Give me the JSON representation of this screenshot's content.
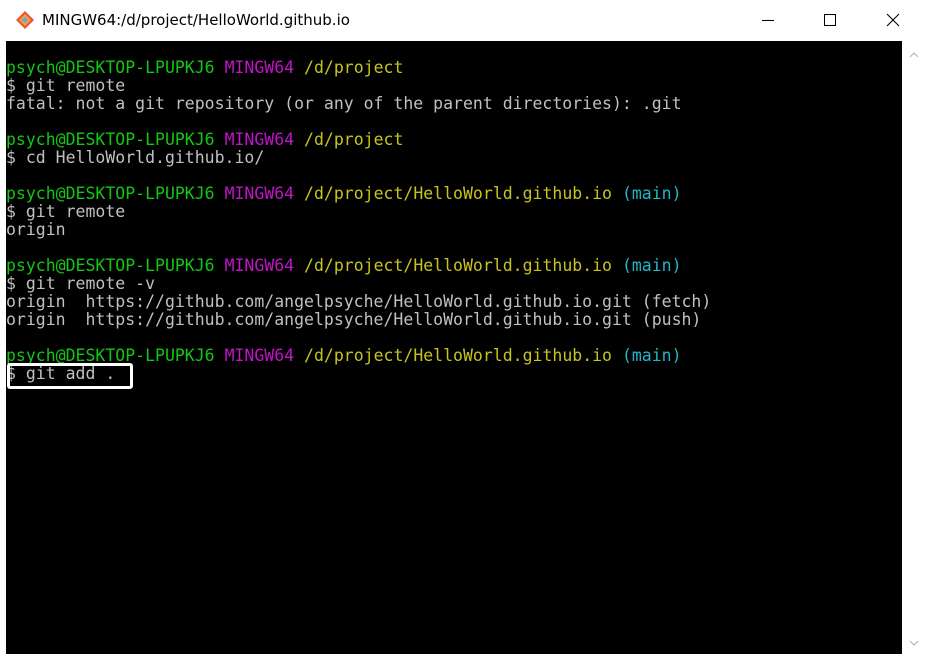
{
  "window": {
    "title": "MINGW64:/d/project/HelloWorld.github.io",
    "icon": "git-diamond-icon",
    "controls": {
      "minimize": "minimize-icon",
      "maximize": "maximize-icon",
      "close": "close-icon"
    }
  },
  "colors": {
    "user": "#12c714",
    "host": "#c113c8",
    "path": "#c8c41e",
    "branch": "#23b6c6",
    "text": "#c0c0c0",
    "background": "#000000"
  },
  "terminal": {
    "lines": [
      {
        "type": "prompt",
        "user": "psych@DESKTOP-LPUPKJ6",
        "host": "MINGW64",
        "path": "/d/project",
        "branch": ""
      },
      {
        "type": "text",
        "text": "$ git remote"
      },
      {
        "type": "text",
        "text": "fatal: not a git repository (or any of the parent directories): .git"
      },
      {
        "type": "blank",
        "text": ""
      },
      {
        "type": "prompt",
        "user": "psych@DESKTOP-LPUPKJ6",
        "host": "MINGW64",
        "path": "/d/project",
        "branch": ""
      },
      {
        "type": "text",
        "text": "$ cd HelloWorld.github.io/"
      },
      {
        "type": "blank",
        "text": ""
      },
      {
        "type": "prompt",
        "user": "psych@DESKTOP-LPUPKJ6",
        "host": "MINGW64",
        "path": "/d/project/HelloWorld.github.io",
        "branch": "(main)"
      },
      {
        "type": "text",
        "text": "$ git remote"
      },
      {
        "type": "text",
        "text": "origin"
      },
      {
        "type": "blank",
        "text": ""
      },
      {
        "type": "prompt",
        "user": "psych@DESKTOP-LPUPKJ6",
        "host": "MINGW64",
        "path": "/d/project/HelloWorld.github.io",
        "branch": "(main)"
      },
      {
        "type": "text",
        "text": "$ git remote -v"
      },
      {
        "type": "text",
        "text": "origin  https://github.com/angelpsyche/HelloWorld.github.io.git (fetch)"
      },
      {
        "type": "text",
        "text": "origin  https://github.com/angelpsyche/HelloWorld.github.io.git (push)"
      },
      {
        "type": "blank",
        "text": ""
      },
      {
        "type": "prompt",
        "user": "psych@DESKTOP-LPUPKJ6",
        "host": "MINGW64",
        "path": "/d/project/HelloWorld.github.io",
        "branch": "(main)"
      },
      {
        "type": "text",
        "text": "$ git add ."
      }
    ]
  }
}
